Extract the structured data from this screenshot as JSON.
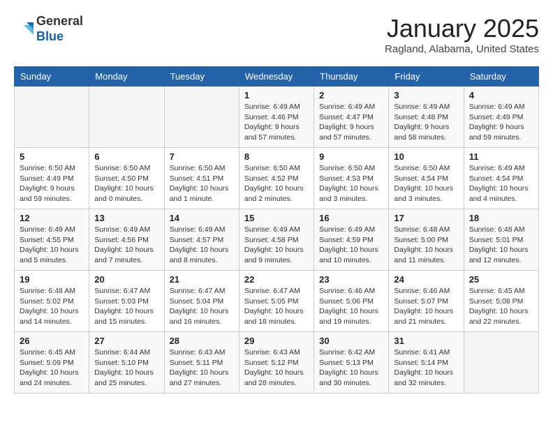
{
  "header": {
    "logo_line1": "General",
    "logo_line2": "Blue",
    "title": "January 2025",
    "subtitle": "Ragland, Alabama, United States"
  },
  "weekdays": [
    "Sunday",
    "Monday",
    "Tuesday",
    "Wednesday",
    "Thursday",
    "Friday",
    "Saturday"
  ],
  "weeks": [
    [
      {
        "day": "",
        "detail": ""
      },
      {
        "day": "",
        "detail": ""
      },
      {
        "day": "",
        "detail": ""
      },
      {
        "day": "1",
        "detail": "Sunrise: 6:49 AM\nSunset: 4:46 PM\nDaylight: 9 hours\nand 57 minutes."
      },
      {
        "day": "2",
        "detail": "Sunrise: 6:49 AM\nSunset: 4:47 PM\nDaylight: 9 hours\nand 57 minutes."
      },
      {
        "day": "3",
        "detail": "Sunrise: 6:49 AM\nSunset: 4:48 PM\nDaylight: 9 hours\nand 58 minutes."
      },
      {
        "day": "4",
        "detail": "Sunrise: 6:49 AM\nSunset: 4:49 PM\nDaylight: 9 hours\nand 59 minutes."
      }
    ],
    [
      {
        "day": "5",
        "detail": "Sunrise: 6:50 AM\nSunset: 4:49 PM\nDaylight: 9 hours\nand 59 minutes."
      },
      {
        "day": "6",
        "detail": "Sunrise: 6:50 AM\nSunset: 4:50 PM\nDaylight: 10 hours\nand 0 minutes."
      },
      {
        "day": "7",
        "detail": "Sunrise: 6:50 AM\nSunset: 4:51 PM\nDaylight: 10 hours\nand 1 minute."
      },
      {
        "day": "8",
        "detail": "Sunrise: 6:50 AM\nSunset: 4:52 PM\nDaylight: 10 hours\nand 2 minutes."
      },
      {
        "day": "9",
        "detail": "Sunrise: 6:50 AM\nSunset: 4:53 PM\nDaylight: 10 hours\nand 3 minutes."
      },
      {
        "day": "10",
        "detail": "Sunrise: 6:50 AM\nSunset: 4:54 PM\nDaylight: 10 hours\nand 3 minutes."
      },
      {
        "day": "11",
        "detail": "Sunrise: 6:49 AM\nSunset: 4:54 PM\nDaylight: 10 hours\nand 4 minutes."
      }
    ],
    [
      {
        "day": "12",
        "detail": "Sunrise: 6:49 AM\nSunset: 4:55 PM\nDaylight: 10 hours\nand 5 minutes."
      },
      {
        "day": "13",
        "detail": "Sunrise: 6:49 AM\nSunset: 4:56 PM\nDaylight: 10 hours\nand 7 minutes."
      },
      {
        "day": "14",
        "detail": "Sunrise: 6:49 AM\nSunset: 4:57 PM\nDaylight: 10 hours\nand 8 minutes."
      },
      {
        "day": "15",
        "detail": "Sunrise: 6:49 AM\nSunset: 4:58 PM\nDaylight: 10 hours\nand 9 minutes."
      },
      {
        "day": "16",
        "detail": "Sunrise: 6:49 AM\nSunset: 4:59 PM\nDaylight: 10 hours\nand 10 minutes."
      },
      {
        "day": "17",
        "detail": "Sunrise: 6:48 AM\nSunset: 5:00 PM\nDaylight: 10 hours\nand 11 minutes."
      },
      {
        "day": "18",
        "detail": "Sunrise: 6:48 AM\nSunset: 5:01 PM\nDaylight: 10 hours\nand 12 minutes."
      }
    ],
    [
      {
        "day": "19",
        "detail": "Sunrise: 6:48 AM\nSunset: 5:02 PM\nDaylight: 10 hours\nand 14 minutes."
      },
      {
        "day": "20",
        "detail": "Sunrise: 6:47 AM\nSunset: 5:03 PM\nDaylight: 10 hours\nand 15 minutes."
      },
      {
        "day": "21",
        "detail": "Sunrise: 6:47 AM\nSunset: 5:04 PM\nDaylight: 10 hours\nand 16 minutes."
      },
      {
        "day": "22",
        "detail": "Sunrise: 6:47 AM\nSunset: 5:05 PM\nDaylight: 10 hours\nand 18 minutes."
      },
      {
        "day": "23",
        "detail": "Sunrise: 6:46 AM\nSunset: 5:06 PM\nDaylight: 10 hours\nand 19 minutes."
      },
      {
        "day": "24",
        "detail": "Sunrise: 6:46 AM\nSunset: 5:07 PM\nDaylight: 10 hours\nand 21 minutes."
      },
      {
        "day": "25",
        "detail": "Sunrise: 6:45 AM\nSunset: 5:08 PM\nDaylight: 10 hours\nand 22 minutes."
      }
    ],
    [
      {
        "day": "26",
        "detail": "Sunrise: 6:45 AM\nSunset: 5:09 PM\nDaylight: 10 hours\nand 24 minutes."
      },
      {
        "day": "27",
        "detail": "Sunrise: 6:44 AM\nSunset: 5:10 PM\nDaylight: 10 hours\nand 25 minutes."
      },
      {
        "day": "28",
        "detail": "Sunrise: 6:43 AM\nSunset: 5:11 PM\nDaylight: 10 hours\nand 27 minutes."
      },
      {
        "day": "29",
        "detail": "Sunrise: 6:43 AM\nSunset: 5:12 PM\nDaylight: 10 hours\nand 28 minutes."
      },
      {
        "day": "30",
        "detail": "Sunrise: 6:42 AM\nSunset: 5:13 PM\nDaylight: 10 hours\nand 30 minutes."
      },
      {
        "day": "31",
        "detail": "Sunrise: 6:41 AM\nSunset: 5:14 PM\nDaylight: 10 hours\nand 32 minutes."
      },
      {
        "day": "",
        "detail": ""
      }
    ]
  ]
}
